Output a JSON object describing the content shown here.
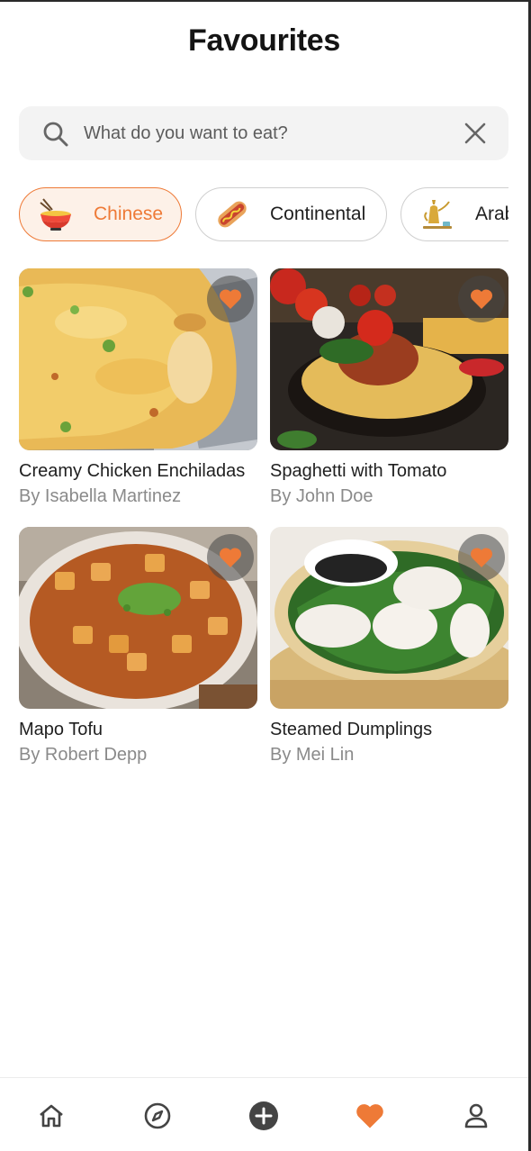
{
  "header": {
    "title": "Favourites"
  },
  "search": {
    "placeholder": "What do you want to eat?",
    "value": ""
  },
  "categories": [
    {
      "label": "Chinese",
      "icon": "noodle-bowl-icon",
      "active": true
    },
    {
      "label": "Continental",
      "icon": "hotdog-icon",
      "active": false
    },
    {
      "label": "Arabic",
      "icon": "dallah-coffee-icon",
      "active": false
    }
  ],
  "recipes": [
    {
      "name": "Creamy Chicken Enchiladas",
      "author": "By Isabella Martinez",
      "favourite": true
    },
    {
      "name": "Spaghetti with Tomato",
      "author": "By John Doe",
      "favourite": true
    },
    {
      "name": "Mapo Tofu",
      "author": "By Robert Depp",
      "favourite": true
    },
    {
      "name": "Steamed Dumplings",
      "author": "By Mei Lin",
      "favourite": true
    }
  ],
  "nav": {
    "items": [
      {
        "id": "home",
        "icon": "home-icon"
      },
      {
        "id": "explore",
        "icon": "compass-icon"
      },
      {
        "id": "add",
        "icon": "add-circle-icon"
      },
      {
        "id": "favourites",
        "icon": "heart-icon",
        "active": true
      },
      {
        "id": "profile",
        "icon": "user-icon"
      }
    ]
  },
  "colors": {
    "accent": "#EE7A37",
    "text": "#1F1F1F",
    "muted": "#8A8A8A",
    "searchBg": "#F3F3F3"
  }
}
